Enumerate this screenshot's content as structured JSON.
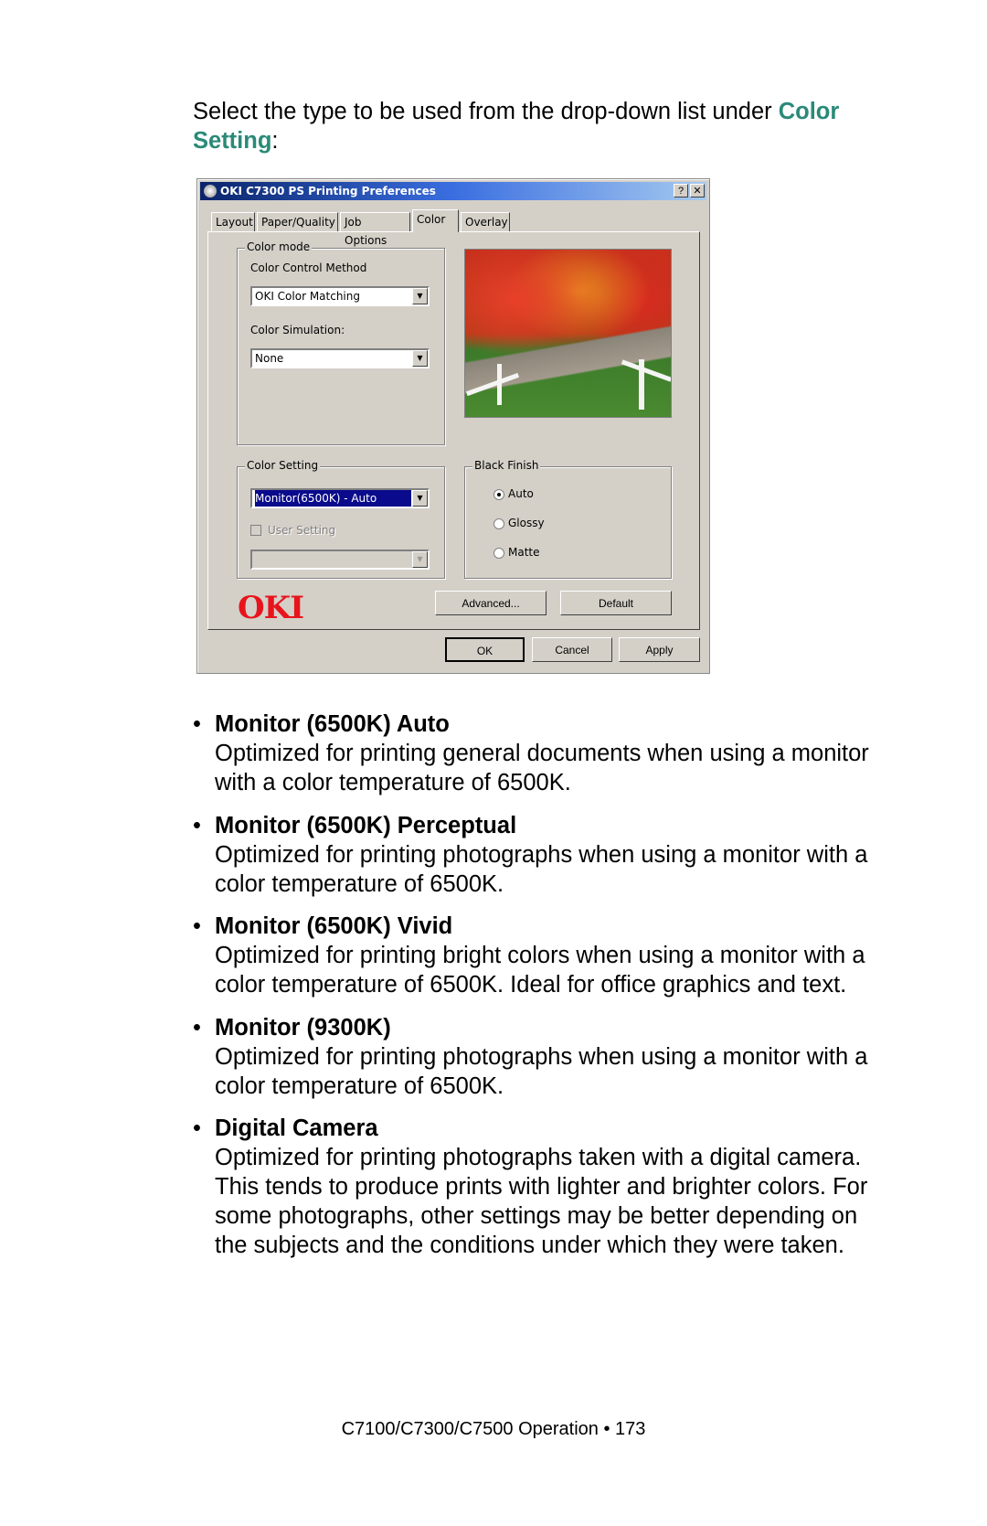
{
  "intro": {
    "text": "Select the type to be used from the drop-down list under ",
    "link": "Color Setting",
    "suffix": ":"
  },
  "colors": {
    "accent": "#2a8a78",
    "title_bar": "#0a246a",
    "oki_red": "#e8141c",
    "selection": "#0a0a8c"
  },
  "dialog": {
    "title": "OKI C7300 PS Printing Preferences",
    "help_button": "?",
    "close_button": "✕",
    "tabs": [
      {
        "label": "Layout"
      },
      {
        "label": "Paper/Quality"
      },
      {
        "label": "Job Options"
      },
      {
        "label": "Color",
        "active": true
      },
      {
        "label": "Overlay"
      }
    ],
    "color_mode": {
      "legend": "Color mode",
      "method_label": "Color Control Method",
      "method_value": "OKI Color Matching",
      "simulation_label": "Color Simulation:",
      "simulation_value": "None"
    },
    "color_setting": {
      "legend": "Color Setting",
      "value": "Monitor(6500K) - Auto",
      "user_setting_label": "User Setting",
      "user_setting_checked": false,
      "user_setting_value": ""
    },
    "black_finish": {
      "legend": "Black Finish",
      "options": [
        {
          "label": "Auto",
          "selected": true
        },
        {
          "label": "Glossy",
          "selected": false
        },
        {
          "label": "Matte",
          "selected": false
        }
      ]
    },
    "logo": "OKI",
    "advanced_button": "Advanced...",
    "default_button": "Default",
    "ok_button": "OK",
    "cancel_button": "Cancel",
    "apply_button": "Apply",
    "dropdown_arrow": "▼"
  },
  "items": [
    {
      "title": "Monitor (6500K) Auto",
      "desc": "Optimized for printing general documents when using a monitor with a color temperature of 6500K."
    },
    {
      "title": "Monitor (6500K) Perceptual",
      "desc": "Optimized for printing photographs when using a monitor with a color temperature of 6500K."
    },
    {
      "title": "Monitor (6500K) Vivid",
      "desc": "Optimized for printing bright colors when using a monitor with a color temperature of 6500K. Ideal for office graphics and text."
    },
    {
      "title": "Monitor (9300K)",
      "desc": "Optimized for printing photographs when using a monitor with a color temperature of 6500K."
    },
    {
      "title": "Digital Camera",
      "desc": "Optimized for printing photographs taken with a digital camera. This tends to produce prints with lighter and brighter colors. For some photographs, other settings may be better depending on the subjects and the conditions under which they were taken."
    }
  ],
  "footer": "C7100/C7300/C7500  Operation • 173"
}
